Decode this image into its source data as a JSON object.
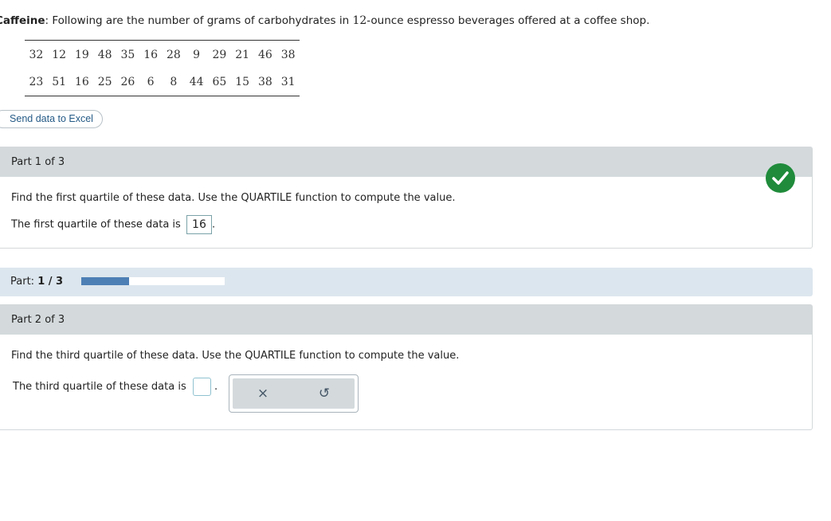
{
  "problem": {
    "label": "Caffeine",
    "colon": ":",
    "text_before": " Following are the number of grams of carbohydrates in ",
    "number": "12",
    "text_after": "-ounce espresso beverages offered at a coffee shop."
  },
  "data_table": {
    "rows": [
      [
        "32",
        "12",
        "19",
        "48",
        "35",
        "16",
        "28",
        "9",
        "29",
        "21",
        "46",
        "38"
      ],
      [
        "23",
        "51",
        "16",
        "25",
        "26",
        "6",
        "8",
        "44",
        "65",
        "15",
        "38",
        "31"
      ]
    ]
  },
  "excel_button": {
    "label": "Send data to Excel"
  },
  "part1": {
    "header": "Part 1 of 3",
    "question": "Find the first quartile of these data. Use the QUARTILE function to compute the value.",
    "answer_prefix": "The first quartile of these data is",
    "answer_value": "16",
    "answer_suffix": ".",
    "status_icon": "checkmark-icon",
    "status_color": "#1f8b3b"
  },
  "progress": {
    "label": "Part:",
    "value": "1 / 3",
    "fraction": 0.333
  },
  "part2": {
    "header": "Part 2 of 3",
    "question": "Find the third quartile of these data. Use the QUARTILE function to compute the value.",
    "answer_prefix": "The third quartile of these data is",
    "answer_value": "",
    "answer_suffix": ".",
    "tools": {
      "clear_icon": "x-icon",
      "clear_glyph": "×",
      "undo_icon": "undo-icon",
      "undo_glyph": "↺"
    }
  }
}
